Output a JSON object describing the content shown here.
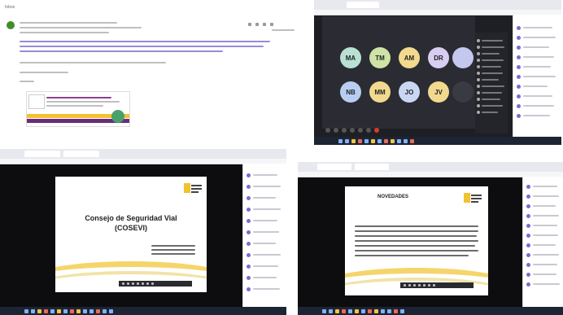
{
  "email": {
    "folder_label": "Inbox",
    "sender_initial": "",
    "body_greeting": "",
    "link_text": ""
  },
  "videocall": {
    "participants": [
      {
        "initials": "MA",
        "color": "#b9e1d3"
      },
      {
        "initials": "TM",
        "color": "#cfe3a6"
      },
      {
        "initials": "AM",
        "color": "#f2d98e"
      },
      {
        "initials": "DR",
        "color": "#d8cef1"
      },
      {
        "initials": "",
        "color": "#c4c7ee"
      },
      {
        "initials": "NB",
        "color": "#b7cdf1"
      },
      {
        "initials": "MM",
        "color": "#f2d98e"
      },
      {
        "initials": "JO",
        "color": "#c9d7f3"
      },
      {
        "initials": "JV",
        "color": "#f2d98e"
      },
      {
        "initials": "",
        "color": "#3a3b42"
      }
    ]
  },
  "presentation1": {
    "title_line1": "Consejo de Seguridad Vial",
    "title_line2": "(COSEVI)"
  },
  "presentation2": {
    "title": "NOVEDADES"
  }
}
